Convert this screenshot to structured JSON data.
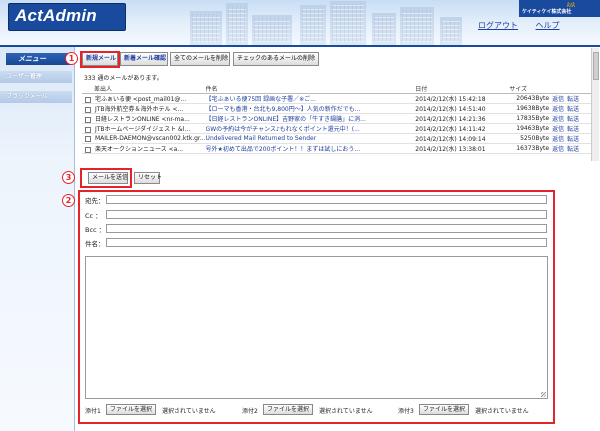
{
  "header": {
    "logo": "ActAdmin",
    "links": {
      "logout": "ログアウト",
      "help": "ヘルプ"
    },
    "company_mark": "ktk",
    "company_name": "ケイティケイ株式会社"
  },
  "sidebar": {
    "title": "メニュー",
    "items": [
      {
        "label": "ユーザー管理"
      },
      {
        "label": "ブラックメール"
      }
    ]
  },
  "toolbar": {
    "new_mail": "新規メール",
    "new_check": "新着メール確認",
    "delete_all": "全てのメールを削除",
    "delete_checked": "チェックのあるメールの削除"
  },
  "callouts": {
    "one": "1",
    "two": "2",
    "three": "3"
  },
  "mail_list": {
    "count_text": "333 通のメールがあります。",
    "columns": {
      "from": "差出人",
      "subject": "件名",
      "date": "日付",
      "size": "サイズ"
    },
    "rows": [
      {
        "from": "宅ふぁいる便 <post_mail01@...",
        "subject": "【宅ふぁいる便75回 録画な子署／※ご...",
        "date": "2014/2/12(水) 15:42:18",
        "size": "20643Byte",
        "reply": "返信",
        "forward": "転送"
      },
      {
        "from": "JTB海外航空券＆海外ホテル <...",
        "subject": "【ローマも香港・台北も9,800円〜】人気の新作だでも...",
        "date": "2014/2/12(水) 14:51:40",
        "size": "19638Byte",
        "reply": "返信",
        "forward": "転送"
      },
      {
        "from": "日経レストランONLINE <nr-ma...",
        "subject": "【日経レストランONLINE】吉野家の「牛すき鍋膳」に消...",
        "date": "2014/2/12(水) 14:21:36",
        "size": "17835Byte",
        "reply": "返信",
        "forward": "転送"
      },
      {
        "from": "JTBホームページダイジェスト &l...",
        "subject": "GWの予約は今がチャンス♪もれなくポイント還元中！(...",
        "date": "2014/2/12(水) 14:11:42",
        "size": "19463Byte",
        "reply": "返信",
        "forward": "転送"
      },
      {
        "from": "MAILER-DAEMON@vscan002.ktk.gr...",
        "subject": "Undelivered Mail Returned to Sender",
        "date": "2014/2/12(水) 14:09:14",
        "size": "5250Byte",
        "reply": "返信",
        "forward": "転送"
      },
      {
        "from": "楽天オークションニュース <a...",
        "subject": "号外★初めて出品で200ポイント！！まずは試しにおう...",
        "date": "2014/2/12(水) 13:38:01",
        "size": "16373Byte",
        "reply": "返信",
        "forward": "転送"
      }
    ]
  },
  "send_bar": {
    "send": "メールを送信",
    "reset": "リセット"
  },
  "compose": {
    "to_label": "宛先：",
    "cc_label": "Cc ：",
    "bcc_label": "Bcc ：",
    "subject_label": "件名：",
    "attachments": [
      {
        "label": "添付1",
        "button": "ファイルを選択",
        "status": "選択されていません"
      },
      {
        "label": "添付2",
        "button": "ファイルを選択",
        "status": "選択されていません"
      },
      {
        "label": "添付3",
        "button": "ファイルを選択",
        "status": "選択されていません"
      }
    ]
  },
  "colors": {
    "brand": "#1a4a9e",
    "callout": "#e5232b",
    "link": "#1f3fa0"
  }
}
